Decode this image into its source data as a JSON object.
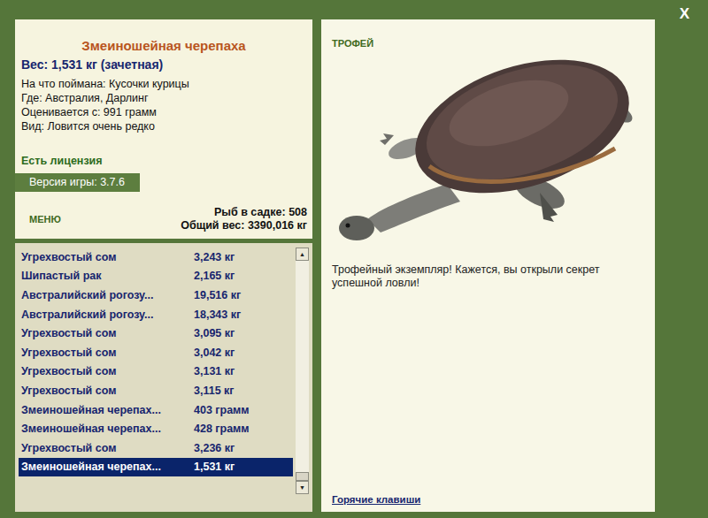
{
  "window": {
    "close": "X"
  },
  "details": {
    "title": "Змеиношейная черепаха",
    "weight": "Вес: 1,531 кг (зачетная)",
    "lines": [
      "На что поймана: Кусочки курицы",
      "Где: Австралия, Дарлинг",
      "Оценивается с: 991 грамм",
      "Вид: Ловится очень редко"
    ]
  },
  "license": "Есть лицензия",
  "version": "Версия игры: 3.7.6",
  "menu": "МЕНЮ",
  "keepnet": {
    "count": "Рыб в садке: 508",
    "total": "Общий вес: 3390,016 кг"
  },
  "catch_list": {
    "rows": [
      {
        "name": "Угрехвостый сом",
        "weight": "3,243 кг",
        "selected": false
      },
      {
        "name": "Шипастый рак",
        "weight": "2,165 кг",
        "selected": false
      },
      {
        "name": "Австралийский рогозу...",
        "weight": "19,516 кг",
        "selected": false
      },
      {
        "name": "Австралийский рогозу...",
        "weight": "18,343 кг",
        "selected": false
      },
      {
        "name": "Угрехвостый сом",
        "weight": "3,095 кг",
        "selected": false
      },
      {
        "name": "Угрехвостый сом",
        "weight": "3,042 кг",
        "selected": false
      },
      {
        "name": "Угрехвостый сом",
        "weight": "3,131 кг",
        "selected": false
      },
      {
        "name": "Угрехвостый сом",
        "weight": "3,115 кг",
        "selected": false
      },
      {
        "name": "Змеиношейная черепах...",
        "weight": "403 грамм",
        "selected": false
      },
      {
        "name": "Змеиношейная черепах...",
        "weight": "428 грамм",
        "selected": false
      },
      {
        "name": "Угрехвостый сом",
        "weight": "3,236 кг",
        "selected": false
      },
      {
        "name": "Змеиношейная черепах...",
        "weight": "1,531 кг",
        "selected": true
      }
    ],
    "scrollbar": {
      "up": "▲",
      "down": "▼",
      "level": 1
    }
  },
  "trophy": {
    "badge": "ТРОФЕЙ",
    "message": "Трофейный экземпляр! Кажется, вы открыли секрет успешной ловли!",
    "hotkeys": "Горячие клавиши"
  }
}
